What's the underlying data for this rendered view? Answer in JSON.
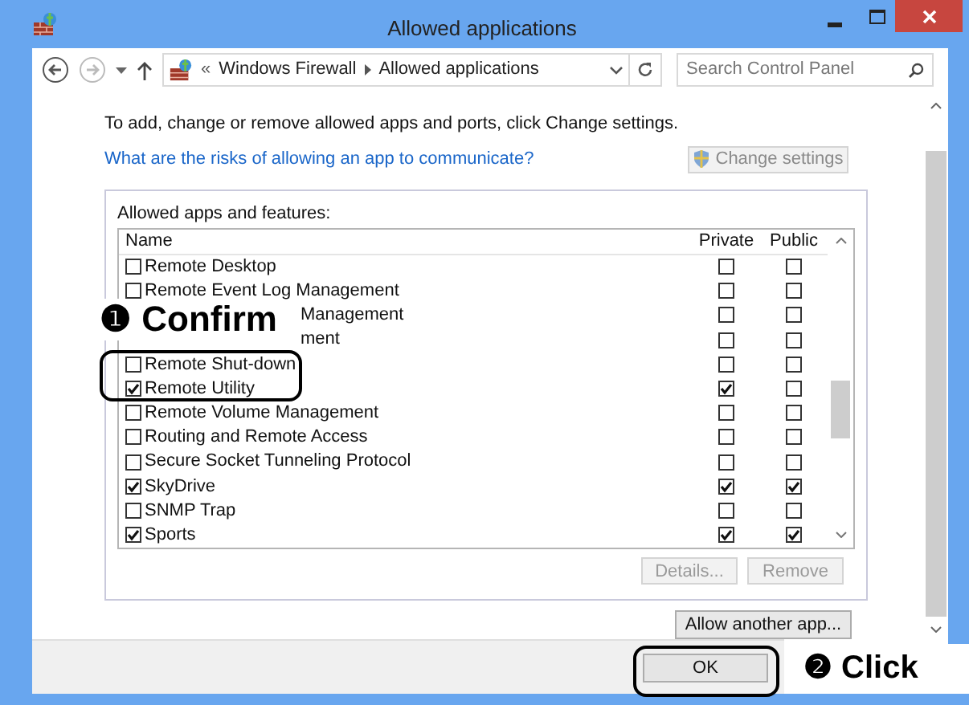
{
  "window": {
    "title": "Allowed applications"
  },
  "address_bar": {
    "overflow": "«",
    "path": [
      "Windows Firewall",
      "Allowed applications"
    ]
  },
  "search": {
    "placeholder": "Search Control Panel"
  },
  "instructions": "To add, change or remove allowed apps and ports, click Change settings.",
  "risks_link": "What are the risks of allowing an app to communicate?",
  "change_settings_button": {
    "label": "Change settings",
    "disabled": true
  },
  "apps": {
    "title": "Allowed apps and features:",
    "columns": [
      "Name",
      "Private",
      "Public"
    ],
    "rows": [
      {
        "kind": "row",
        "name": "Remote Desktop",
        "checked": false,
        "private": false,
        "public": false
      },
      {
        "kind": "row",
        "name": "Remote Event Log Management",
        "checked": false,
        "private": false,
        "public": false
      },
      {
        "kind": "covered",
        "name": "Management",
        "private": false,
        "public": false
      },
      {
        "kind": "covered",
        "name": "ment",
        "private": false,
        "public": false
      },
      {
        "kind": "row",
        "name": "Remote Shut-down",
        "checked": false,
        "private": false,
        "public": false
      },
      {
        "kind": "row",
        "name": "Remote Utility",
        "checked": true,
        "private": true,
        "public": false
      },
      {
        "kind": "row",
        "name": "Remote Volume Management",
        "checked": false,
        "private": false,
        "public": false
      },
      {
        "kind": "row",
        "name": "Routing and Remote Access",
        "checked": false,
        "private": false,
        "public": false
      },
      {
        "kind": "row",
        "name": "Secure Socket Tunneling Protocol",
        "checked": false,
        "private": false,
        "public": false
      },
      {
        "kind": "row",
        "name": "SkyDrive",
        "checked": true,
        "private": true,
        "public": true
      },
      {
        "kind": "row",
        "name": "SNMP Trap",
        "checked": false,
        "private": false,
        "public": false
      },
      {
        "kind": "row",
        "name": "Sports",
        "checked": true,
        "private": true,
        "public": true
      }
    ]
  },
  "details_button": {
    "label": "Details...",
    "disabled": true
  },
  "remove_button": {
    "label": "Remove",
    "disabled": true
  },
  "allow_another_button": {
    "label": "Allow another app...",
    "disabled": false
  },
  "ok_button": {
    "label": "OK"
  },
  "callouts": [
    {
      "number": "❶",
      "label": "Confirm"
    },
    {
      "number": "❷",
      "label": "Click"
    }
  ]
}
